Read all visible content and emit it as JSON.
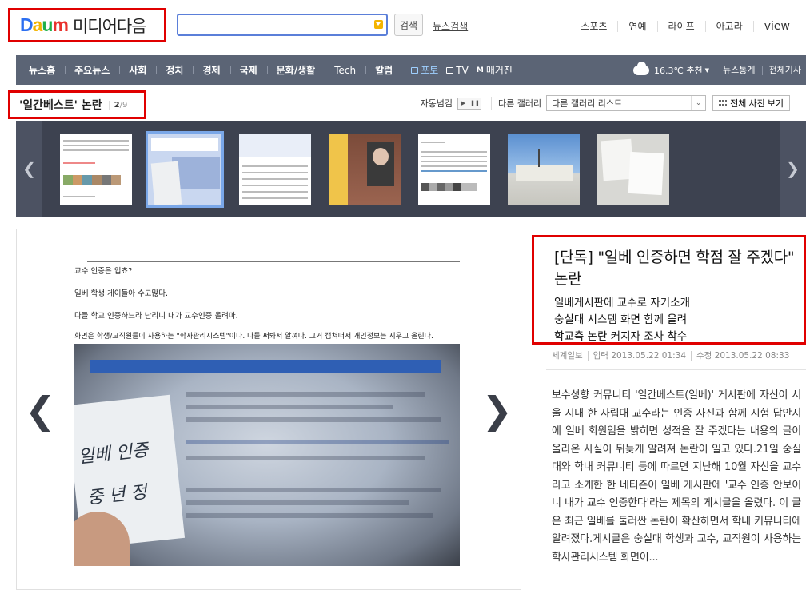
{
  "header": {
    "logo_word": "Daum",
    "logo_text": "미디어다음",
    "search_placeholder": "",
    "search_button": "검색",
    "news_search": "뉴스검색",
    "top_links": [
      "스포츠",
      "연예",
      "라이프",
      "아고라",
      "view"
    ]
  },
  "nav": {
    "items": [
      "뉴스홈",
      "주요뉴스",
      "사회",
      "정치",
      "경제",
      "국제",
      "문화/생활",
      "Tech",
      "칼럼"
    ],
    "media": [
      "포토",
      "TV",
      "매거진"
    ],
    "weather": "16.3℃  춘천",
    "right_links": [
      "뉴스통계",
      "전체기사"
    ]
  },
  "gallery": {
    "title": "'일간베스트' 논란",
    "current": "2",
    "total": "/9",
    "autoplay_label": "자동넘김",
    "other_gallery_label": "다른 갤러리",
    "other_gallery_select": "다른 갤러리 리스트",
    "view_all": "전체 사진 보기"
  },
  "photo": {
    "lines": [
      "교수 인증은 입쵸?",
      "일베 학생 게이들아 수고많다.",
      "다들 학교 인증하느라 난리니 내가 교수인증 올려마.",
      "화면은 학생/교직원들이 사용하는 \"학사관리시스템\"이다. 다들 써봐서 알껴다. 그거 캡쳐떠서 개인정보는 지우고 올린다."
    ],
    "note_line1": "일베 인증",
    "note_line2": "중 년 정"
  },
  "article": {
    "headline": "[단독] \"일베 인증하면 학점 잘 주겠다\" 논란",
    "subheads": [
      "일베게시판에 교수로 자기소개",
      "숭실대 시스템 화면 함께 올려",
      "학교측 논란 커지자 조사 착수"
    ],
    "source": "세계일보",
    "input_date": "입력 2013.05.22 01:34",
    "modify_date": "수정 2013.05.22 08:33",
    "body": "보수성향 커뮤니티 '일간베스트(일베)' 게시판에 자신이 서울 시내 한 사립대 교수라는 인증 사진과 함께 시험 답안지에 일베 회원임을 밝히면 성적을 잘 주겠다는 내용의 글이 올라온 사실이 뒤늦게 알려져 논란이 일고 있다.21일 숭실대와 학내 커뮤니티 등에 따르면 지난해 10월 자신을 교수라고 소개한 한 네티즌이 일베 게시판에 '교수 인증 안보이니 내가 교수 인증한다'라는 제목의 게시글을 올렸다. 이 글은 최근 일베를 둘러싼 논란이 확산하면서 학내 커뮤니티에 알려졌다.게시글은 숭실대 학생과 교수, 교직원이 사용하는 학사관리시스템 화면이..."
  },
  "colors": {
    "highlight_border": "#e00000",
    "nav_bg": "#5b6475",
    "strip_bg": "#3d4250",
    "search_border": "#5b7fd9"
  }
}
